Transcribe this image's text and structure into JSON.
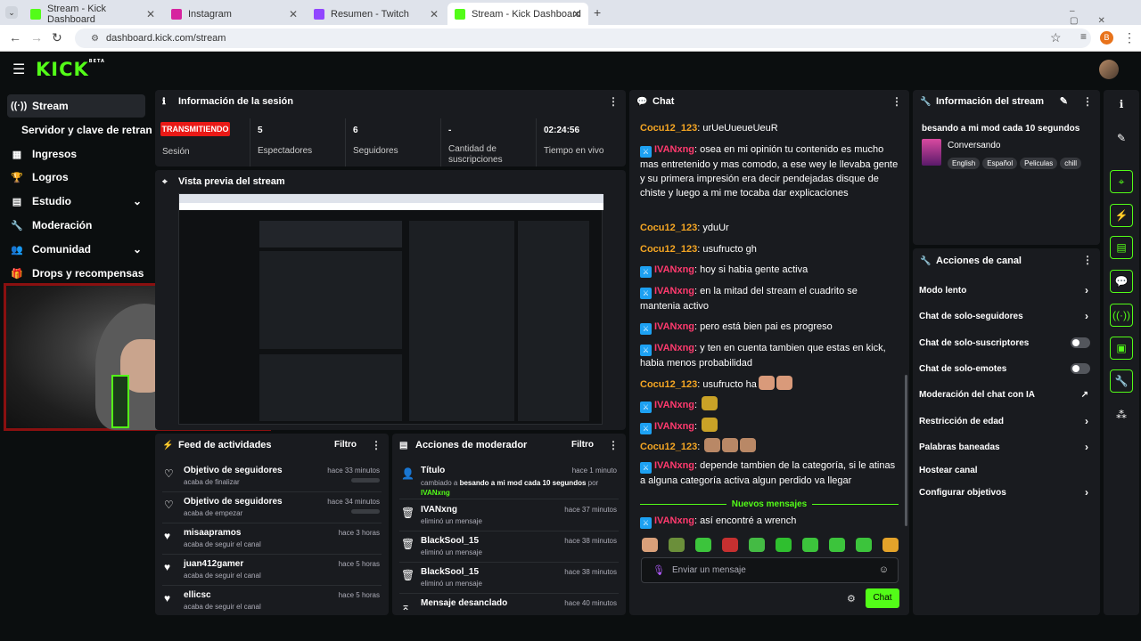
{
  "browser": {
    "tabs": [
      {
        "title": "Stream - Kick Dashboard"
      },
      {
        "title": "Instagram"
      },
      {
        "title": "Resumen - Twitch"
      },
      {
        "title": "Stream - Kick Dashboard"
      }
    ],
    "url": "dashboard.kick.com/stream",
    "profile": "B"
  },
  "sidebar": {
    "items": [
      {
        "label": "Stream"
      },
      {
        "label": "Servidor y clave de retransm"
      },
      {
        "label": "Ingresos"
      },
      {
        "label": "Logros"
      },
      {
        "label": "Estudio"
      },
      {
        "label": "Moderación"
      },
      {
        "label": "Comunidad"
      },
      {
        "label": "Drops y recompensas"
      }
    ]
  },
  "logo": "KICK",
  "logo_beta": "BETA",
  "session": {
    "title": "Información de la sesión",
    "live": "TRANSMITIENDO",
    "live_label": "Sesión",
    "stats": [
      {
        "value": "5",
        "label": "Espectadores"
      },
      {
        "value": "6",
        "label": "Seguidores"
      },
      {
        "value": "-",
        "label": "Cantidad de suscripciones"
      },
      {
        "value": "02:24:56",
        "label": "Tiempo en vivo"
      }
    ]
  },
  "preview": {
    "title": "Vista previa del stream"
  },
  "feed": {
    "title": "Feed de actividades",
    "filter": "Filtro",
    "rows": [
      {
        "title": "Objetivo de seguidores",
        "sub": "acaba de finalizar",
        "time": "hace 33 minutos"
      },
      {
        "title": "Objetivo de seguidores",
        "sub": "acaba de empezar",
        "time": "hace 34 minutos"
      },
      {
        "title": "misaapramos",
        "sub": "acaba de seguir el canal",
        "time": "hace 3 horas"
      },
      {
        "title": "juan412gamer",
        "sub": "acaba de seguir el canal",
        "time": "hace 5 horas"
      },
      {
        "title": "ellicsc",
        "sub": "acaba de seguir el canal",
        "time": "hace 5 horas"
      }
    ]
  },
  "modactions": {
    "title": "Acciones de moderador",
    "filter": "Filtro",
    "first": {
      "title": "Título",
      "time": "hace 1 minuto",
      "pre": "cambiado a",
      "bold": "besando a mi mod cada 10 segundos",
      "by": "por",
      "user": "IVANxng"
    },
    "rows": [
      {
        "title": "IVANxng",
        "sub": "eliminó un mensaje",
        "time": "hace 37 minutos"
      },
      {
        "title": "BlackSool_15",
        "sub": "eliminó un mensaje",
        "time": "hace 38 minutos"
      },
      {
        "title": "BlackSool_15",
        "sub": "eliminó un mensaje",
        "time": "hace 38 minutos"
      },
      {
        "title": "Mensaje desanclado",
        "sub": "",
        "time": "hace 40 minutos"
      }
    ]
  },
  "chat": {
    "title": "Chat",
    "new_messages": "Nuevos mensajes",
    "placeholder": "Enviar un mensaje",
    "send": "Chat",
    "messages": [
      {
        "user": "Cocu12_123",
        "text": "urUeUueueUeuR"
      },
      {
        "user": "IVANxng",
        "text": "osea en mi opinión tu contenido es mucho mas entretenido y mas comodo, a ese wey le llevaba gente y su primera impresión era decir pendejadas disque de chiste y luego a mi me tocaba dar explicaciones"
      },
      {
        "user": "Cocu12_123",
        "text": "yduUr"
      },
      {
        "user": "Cocu12_123",
        "text": "usufructo gh"
      },
      {
        "user": "IVANxng",
        "text": "hoy si habia gente activa"
      },
      {
        "user": "IVANxng",
        "text": "en la mitad del stream el cuadrito se mantenia activo"
      },
      {
        "user": "IVANxng",
        "text": "pero está bien pai es progreso"
      },
      {
        "user": "IVANxng",
        "text": "y ten en cuenta tambien que estas en kick, habia menos probabilidad"
      },
      {
        "user": "Cocu12_123",
        "text": "usufructo ha"
      },
      {
        "user": "IVANxng",
        "text": ""
      },
      {
        "user": "IVANxng",
        "text": ""
      },
      {
        "user": "Cocu12_123",
        "text": ""
      },
      {
        "user": "IVANxng",
        "text": "depende tambien de la categoría, si le atinas a alguna categoría activa algun perdido va llegar"
      },
      {
        "user": "IVANxng",
        "text": "así encontré a wrench"
      }
    ]
  },
  "streaminfo": {
    "title": "Información del stream",
    "stream_title": "besando a mi mod cada 10 segundos",
    "category": "Conversando",
    "tags": [
      "English",
      "Español",
      "Peliculas",
      "chill"
    ]
  },
  "channel": {
    "title": "Acciones de canal",
    "items": [
      "Modo lento",
      "Chat de solo-seguidores",
      "Chat de solo-suscriptores",
      "Chat de solo-emotes",
      "Moderación del chat con IA",
      "Restricción de edad",
      "Palabras baneadas",
      "Hostear canal",
      "Configurar objetivos"
    ]
  },
  "colors": {
    "accent": "#53fc18",
    "live": "#e91916",
    "panel": "#191b1f"
  }
}
